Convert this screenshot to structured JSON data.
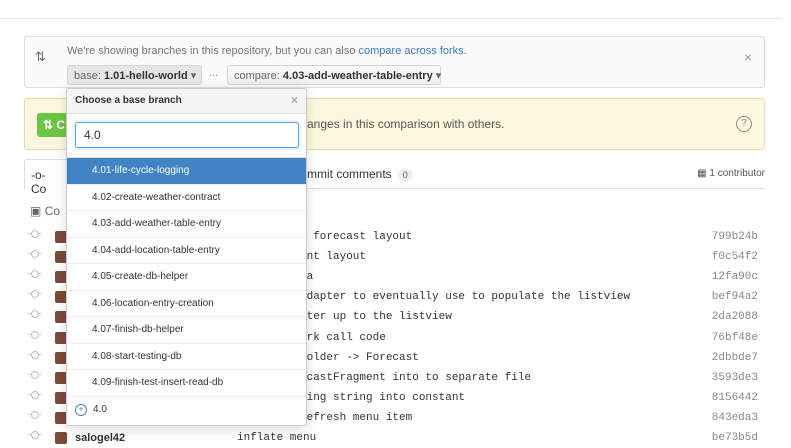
{
  "branch_bar": {
    "info_text": "We're showing branches in this repository, but you can also ",
    "info_link": "compare across forks.",
    "base_prefix": "base: ",
    "base_branch": "1.01-hello-world",
    "ellipsis": "...",
    "compare_prefix": "compare: ",
    "compare_branch": "4.03-add-weather-table-entry",
    "close": "×"
  },
  "banner": {
    "button_label": "C",
    "text": "anges in this comparison with others.",
    "help": "?"
  },
  "tabs": {
    "commits_label": "Co",
    "comments_label": "mmit comments",
    "comments_count": "0",
    "contributors": "1 contributor"
  },
  "group_label": "Co",
  "commits": [
    {
      "author": "",
      "message": "m forecast layout",
      "sha": "799b24b"
    },
    {
      "author": "",
      "message": "ent layout",
      "sha": "f0c54f2"
    },
    {
      "author": "",
      "message": "ta",
      "sha": "12fa90c"
    },
    {
      "author": "",
      "message": "Adapter to eventually use to populate the listview",
      "sha": "bef94a2"
    },
    {
      "author": "",
      "message": "pter up to the listview",
      "sha": "2da2088"
    },
    {
      "author": "",
      "message": "ork call code",
      "sha": "76bf48e"
    },
    {
      "author": "",
      "message": "holder -> Forecast",
      "sha": "2dbbde7"
    },
    {
      "author": "",
      "message": "ecastFragment into to separate file",
      "sha": "3593de3"
    },
    {
      "author": "",
      "message": "ging string into constant",
      "sha": "8156442"
    },
    {
      "author": "",
      "message": "refresh menu item",
      "sha": "843eda3"
    },
    {
      "author": "salogel42",
      "message": "inflate menu",
      "sha": "be73b5d"
    }
  ],
  "dropdown": {
    "title": "Choose a base branch",
    "close": "×",
    "filter_value": "4.0",
    "items": [
      "4.01-life-cycle-logging",
      "4.02-create-weather-contract",
      "4.03-add-weather-table-entry",
      "4.04-add-location-table-entry",
      "4.05-create-db-helper",
      "4.06-location-entry-creation",
      "4.07-finish-db-helper",
      "4.08-start-testing-db",
      "4.09-finish-test-insert-read-db"
    ],
    "create_label": "4.0"
  }
}
